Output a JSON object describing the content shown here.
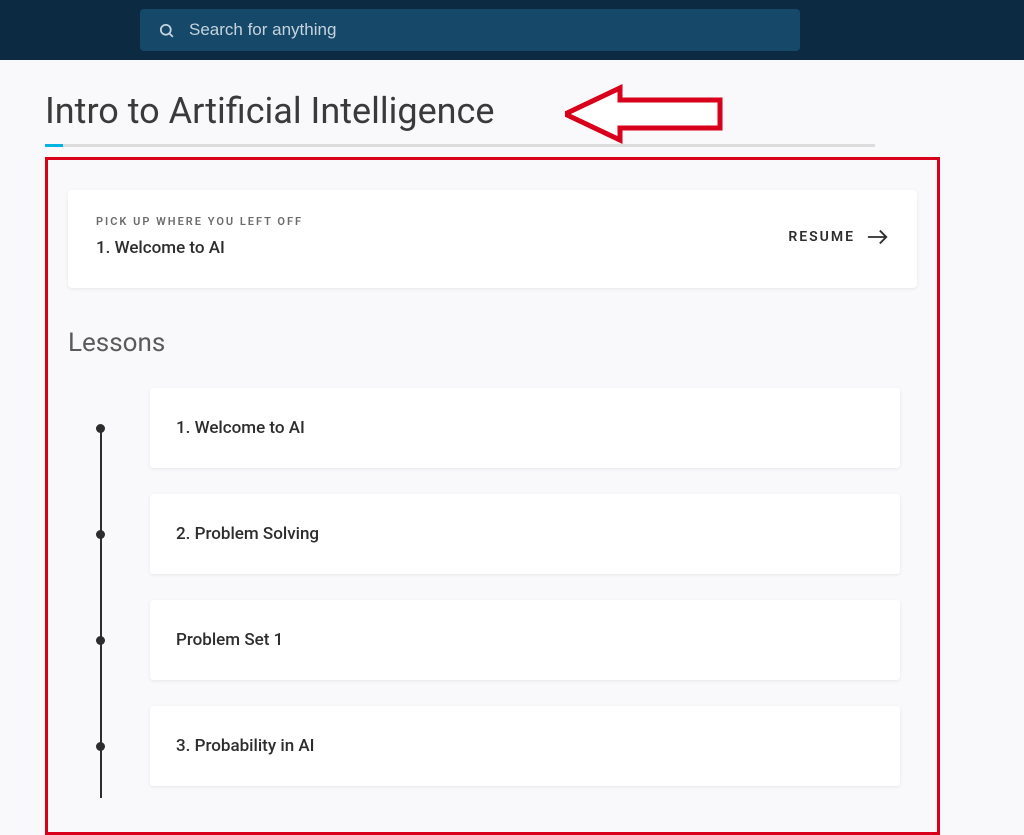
{
  "search": {
    "placeholder": "Search for anything"
  },
  "page": {
    "title": "Intro to Artificial Intelligence"
  },
  "resume": {
    "label": "PICK UP WHERE YOU LEFT OFF",
    "item_title": "1. Welcome to AI",
    "action_label": "RESUME"
  },
  "lessons": {
    "heading": "Lessons",
    "items": [
      {
        "title": "1. Welcome to AI"
      },
      {
        "title": "2. Problem Solving"
      },
      {
        "title": "Problem Set 1"
      },
      {
        "title": "3. Probability in AI"
      }
    ]
  }
}
